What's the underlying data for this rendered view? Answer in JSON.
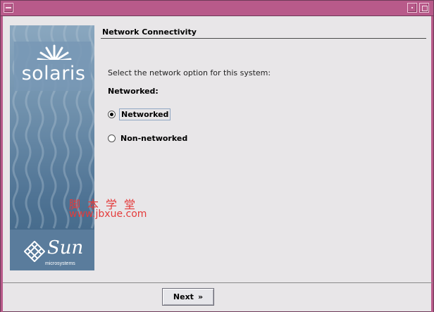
{
  "window": {
    "title": ""
  },
  "banner": {
    "product_name": "solaris",
    "vendor_name": "Sun",
    "vendor_tagline": "microsystems"
  },
  "content": {
    "heading": "Network Connectivity",
    "prompt": "Select the network option for this system:",
    "group_label": "Networked:",
    "options": [
      {
        "label": "Networked",
        "selected": true
      },
      {
        "label": "Non-networked",
        "selected": false
      }
    ]
  },
  "watermark": {
    "line1": "脚本学堂",
    "line2": "www.jbxue.com"
  },
  "footer": {
    "next_label": "Next",
    "next_icon": "double-chevron-right-icon"
  },
  "colors": {
    "titlebar": "#b85a8a",
    "banner_top": "#8aa7bf",
    "banner_bottom": "#3d6383",
    "watermark": "#e43b3b"
  }
}
